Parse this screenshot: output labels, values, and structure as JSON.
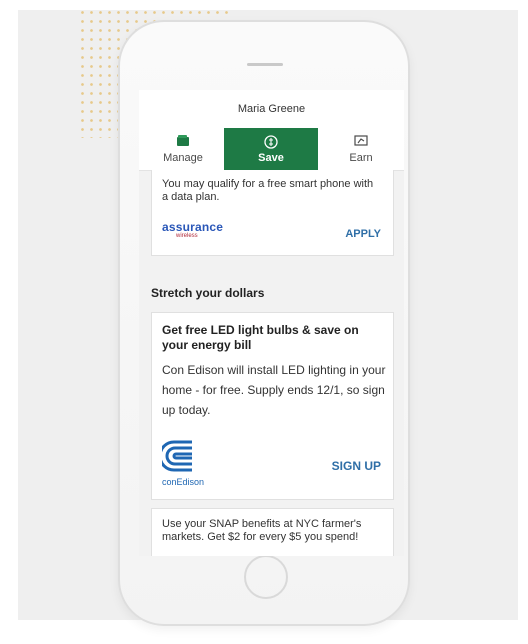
{
  "header": {
    "user_name": "Maria Greene"
  },
  "tabs": [
    {
      "label": "Manage",
      "icon": "wallet-icon"
    },
    {
      "label": "Save",
      "icon": "piggy-bank-icon",
      "active": true
    },
    {
      "label": "Earn",
      "icon": "money-icon"
    }
  ],
  "offers": {
    "assurance": {
      "description": "You may qualify for a free smart phone with a data plan.",
      "logo_text": "assurance",
      "logo_subtext": "wireless",
      "action_label": "APPLY"
    },
    "section_title": "Stretch your dollars",
    "led": {
      "title": "Get free LED light bulbs & save on your energy bill",
      "body": "Con Edison will install LED lighting in your home - for free. Supply ends 12/1, so sign up today.",
      "logo_text": "conEdison",
      "action_label": "SIGN UP"
    },
    "snap": {
      "text": "Use your SNAP benefits at NYC farmer's markets. Get $2 for every $5 you spend!"
    }
  },
  "colors": {
    "accent_green": "#1e7a45",
    "link_blue": "#2f6fa7",
    "assurance_blue": "#2a57b8",
    "conedison_blue": "#1f67b3"
  }
}
